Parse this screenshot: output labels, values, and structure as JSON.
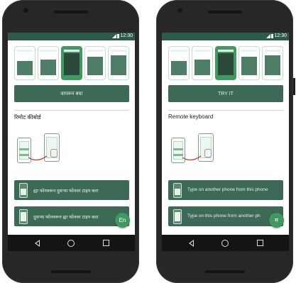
{
  "status_bar": {
    "time": "12:30"
  },
  "left_screen": {
    "try_button": "वापरून बघा",
    "section_title": "रिमोट कीबोर्ड",
    "action_1": "ह्या फोनवरून दुसऱ्या फोनवर टाइप करा",
    "action_2": "दुसऱ्या फोनवरून ह्या फोनवर टाइप करा",
    "fab_label": "En"
  },
  "right_screen": {
    "try_button": "TRY IT",
    "section_title": "Remote keyboard",
    "action_1": "Type on another phone from this phone",
    "action_2": "Type on this phone from another ph",
    "fab_label": "म"
  },
  "colors": {
    "primary_dark": "#2e5b48",
    "button": "#3d6a57",
    "accent": "#3e9a5f"
  },
  "icons": [
    "signal-icon",
    "battery-icon",
    "back-icon",
    "home-icon",
    "recents-icon"
  ]
}
